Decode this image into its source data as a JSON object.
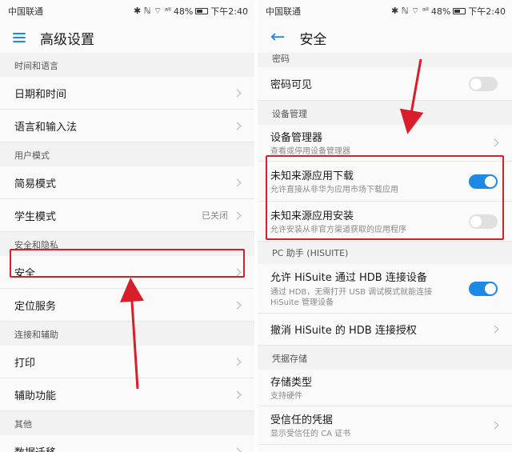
{
  "left": {
    "status": {
      "carrier": "中国联通",
      "icons": "✱ ℕ ⌔ ᵃˡˡ",
      "battery": "48%",
      "time": "下午2:40"
    },
    "title": "高级设置",
    "sections": [
      {
        "header": "时间和语言",
        "items": [
          {
            "label": "日期和时间",
            "value": ""
          },
          {
            "label": "语言和输入法",
            "value": ""
          }
        ]
      },
      {
        "header": "用户模式",
        "items": [
          {
            "label": "简易模式",
            "value": ""
          },
          {
            "label": "学生模式",
            "value": "已关闭"
          }
        ]
      },
      {
        "header": "安全和隐私",
        "items": [
          {
            "label": "安全",
            "value": ""
          },
          {
            "label": "定位服务",
            "value": ""
          }
        ]
      },
      {
        "header": "连接和辅助",
        "items": [
          {
            "label": "打印",
            "value": ""
          },
          {
            "label": "辅助功能",
            "value": ""
          }
        ]
      },
      {
        "header": "其他",
        "items": [
          {
            "label": "数据迁移",
            "value": ""
          }
        ]
      }
    ]
  },
  "right": {
    "status": {
      "carrier": "中国联通",
      "icons": "✱ ℕ ⌔ ᵃˡˡ",
      "battery": "48%",
      "time": "下午2:40"
    },
    "title": "安全",
    "password_header": "密码",
    "password_visible": {
      "label": "密码可见",
      "on": false
    },
    "device_header": "设备管理",
    "device_manager": {
      "label": "设备管理器",
      "sub": "查看或停用设备管理器"
    },
    "unknown_download": {
      "label": "未知来源应用下载",
      "sub": "允许直接从非华为应用市场下载应用",
      "on": true
    },
    "unknown_install": {
      "label": "未知来源应用安装",
      "sub": "允许安装从非官方渠道获取的应用程序",
      "on": false
    },
    "pc_header": "PC 助手 (HISUITE)",
    "hisuite_hdb": {
      "label": "允许 HiSuite 通过 HDB 连接设备",
      "sub1": "通过 HDB，无需打开 USB 调试模式就能连接",
      "sub2": "HiSuite 管理设备",
      "on": true
    },
    "revoke_hdb": {
      "label": "撤消 HiSuite 的 HDB 连接授权"
    },
    "cred_header": "凭据存储",
    "storage_type": {
      "label": "存储类型",
      "sub": "支持硬件"
    },
    "trusted_cred": {
      "label": "受信任的凭据",
      "sub": "显示受信任的 CA 证书"
    }
  },
  "colors": {
    "accent": "#1e88e5",
    "highlight": "#d81e2a"
  }
}
